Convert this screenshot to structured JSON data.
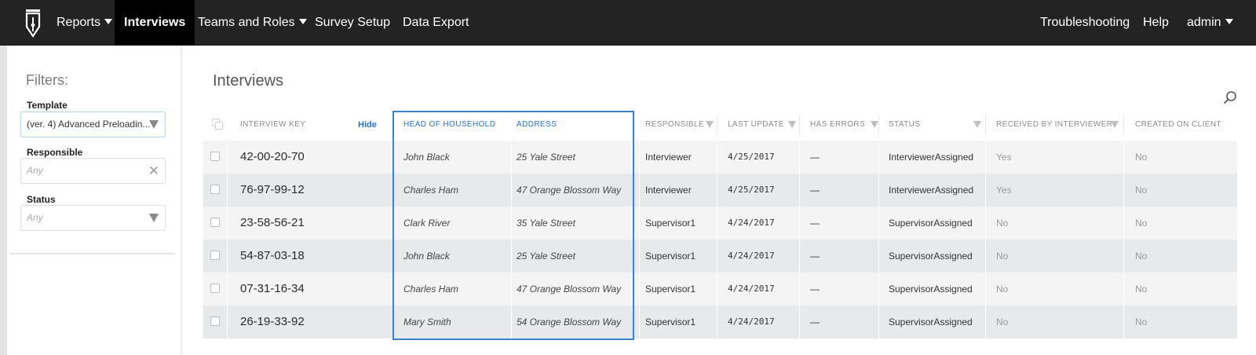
{
  "nav": {
    "left": [
      {
        "label": "Reports",
        "dropdown": true,
        "active": false
      },
      {
        "label": "Interviews",
        "dropdown": false,
        "active": true
      },
      {
        "label": "Teams and Roles",
        "dropdown": true,
        "active": false
      },
      {
        "label": "Survey Setup",
        "dropdown": false,
        "active": false
      },
      {
        "label": "Data Export",
        "dropdown": false,
        "active": false
      }
    ],
    "right": [
      {
        "label": "Troubleshooting",
        "dropdown": false
      },
      {
        "label": "Help",
        "dropdown": false
      },
      {
        "label": "admin",
        "dropdown": true
      }
    ]
  },
  "filters": {
    "title": "Filters:",
    "template": {
      "label": "Template",
      "value": "(ver. 4) Advanced Preloadin..."
    },
    "responsible": {
      "label": "Responsible",
      "placeholder": "Any"
    },
    "status": {
      "label": "Status",
      "placeholder": "Any"
    }
  },
  "page": {
    "title": "Interviews"
  },
  "table": {
    "hide_label": "Hide",
    "headers": {
      "interview_key": "Interview Key",
      "head_of_household": "Head of Household",
      "address": "Address",
      "responsible": "Responsible",
      "last_update": "Last Update",
      "has_errors": "Has Errors",
      "status": "Status",
      "received_by_interviewer": "Received by Interviewer",
      "created_on_client": "Created on Client"
    },
    "rows": [
      {
        "key": "42-00-20-70",
        "hoh": "John Black",
        "address": "25 Yale Street",
        "responsible": "Interviewer",
        "updated": "4/25/2017",
        "errors": "—",
        "status": "InterviewerAssigned",
        "received": "Yes",
        "created": "No"
      },
      {
        "key": "76-97-99-12",
        "hoh": "Charles Ham",
        "address": "47 Orange Blossom Way",
        "responsible": "Interviewer",
        "updated": "4/25/2017",
        "errors": "—",
        "status": "InterviewerAssigned",
        "received": "Yes",
        "created": "No"
      },
      {
        "key": "23-58-56-21",
        "hoh": "Clark River",
        "address": "35 Yale Street",
        "responsible": "Supervisor1",
        "updated": "4/24/2017",
        "errors": "—",
        "status": "SupervisorAssigned",
        "received": "No",
        "created": "No"
      },
      {
        "key": "54-87-03-18",
        "hoh": "John Black",
        "address": "25 Yale Street",
        "responsible": "Supervisor1",
        "updated": "4/24/2017",
        "errors": "—",
        "status": "SupervisorAssigned",
        "received": "No",
        "created": "No"
      },
      {
        "key": "07-31-16-34",
        "hoh": "Charles Ham",
        "address": "47 Orange Blossom Way",
        "responsible": "Supervisor1",
        "updated": "4/24/2017",
        "errors": "—",
        "status": "SupervisorAssigned",
        "received": "No",
        "created": "No"
      },
      {
        "key": "26-19-33-92",
        "hoh": "Mary Smith",
        "address": "54 Orange Blossom Way",
        "responsible": "Supervisor1",
        "updated": "4/24/2017",
        "errors": "—",
        "status": "SupervisorAssigned",
        "received": "No",
        "created": "No"
      }
    ]
  },
  "colors": {
    "navbar": "#232323",
    "accent_blue": "#2a72c8",
    "highlight_box": "#3b82c9"
  }
}
